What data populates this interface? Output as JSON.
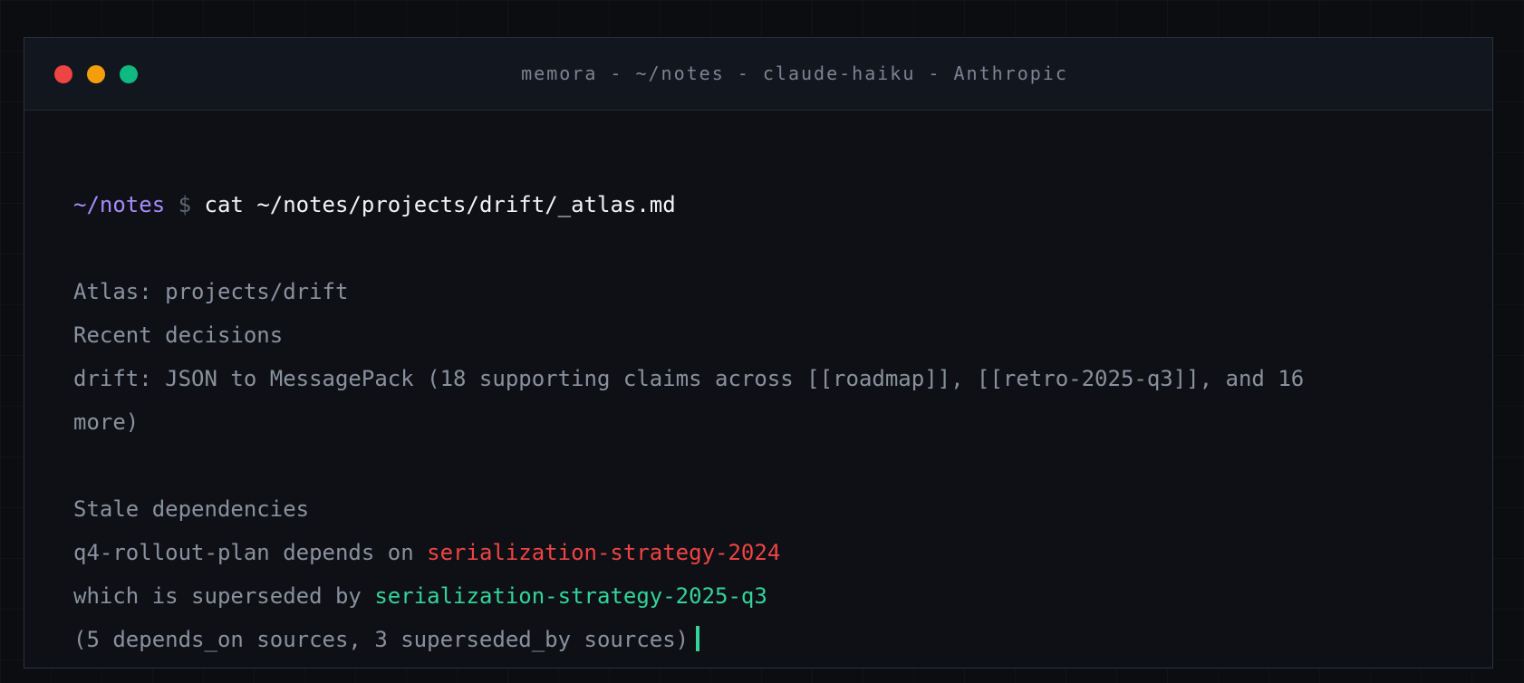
{
  "window": {
    "title": "memora - ~/notes - claude-haiku - Anthropic",
    "controls": {
      "close_color": "#ef4444",
      "minimize_color": "#f59e0b",
      "maximize_color": "#10b981"
    }
  },
  "terminal": {
    "prompt_path": "~/notes",
    "prompt_symbol": "$",
    "command": "cat ~/notes/projects/drift/_atlas.md",
    "atlas_heading": "Atlas: projects/drift",
    "recent_heading": "Recent decisions",
    "decision_line_1": "drift: JSON to MessagePack (18 supporting claims across [[roadmap]], [[retro-2025-q3]], and 16",
    "decision_line_2": "more)",
    "stale_heading": "Stale dependencies",
    "stale_prefix": "q4-rollout-plan depends on ",
    "stale_old": "serialization-strategy-2024",
    "superseded_prefix": "which is superseded by ",
    "stale_new": "serialization-strategy-2025-q3",
    "sources_line": "(5 depends_on sources, 3 superseded_by sources)",
    "cursor_color": "#34d399"
  }
}
